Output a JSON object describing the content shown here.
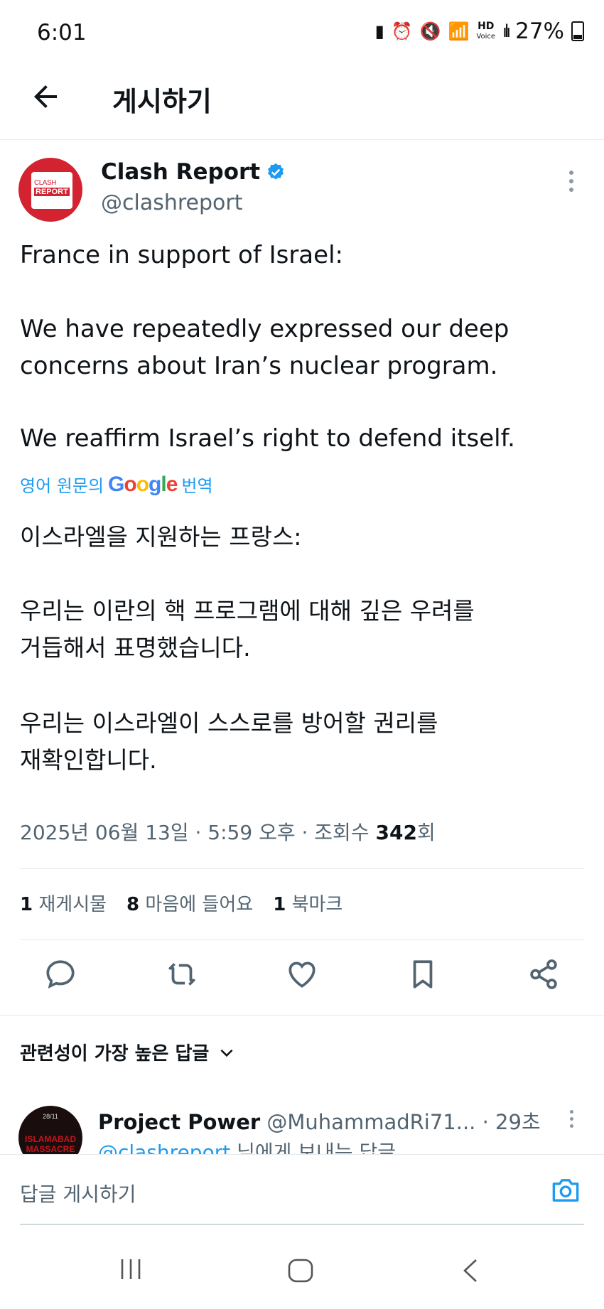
{
  "status_bar": {
    "time": "6:01",
    "network": "HD",
    "network_sub": "Voice",
    "battery": "27%"
  },
  "header": {
    "title": "게시하기"
  },
  "post": {
    "author_name": "Clash Report",
    "author_handle": "@clashreport",
    "avatar_text_top": "CLASH",
    "avatar_text_bottom": "REPORT",
    "text_line1": "France in support of Israel:",
    "text_line2": "We have repeatedly expressed our deep",
    "text_line3": "concerns about Iran’s nuclear program.",
    "text_line4": "We reaffirm Israel’s right to defend itself.",
    "translate_prefix": "영어 원문의",
    "translate_suffix": "번역",
    "translated_line1": "이스라엘을 지원하는 프랑스:",
    "translated_line2": "우리는 이란의 핵 프로그램에 대해 깊은 우려를",
    "translated_line3": "거듭해서 표명했습니다.",
    "translated_line4": "우리는 이스라엘이 스스로를 방어할 권리를",
    "translated_line5": "재확인합니다.",
    "timestamp": "2025년 06월 13일 · 5:59 오후 · 조회수 ",
    "views": "342",
    "views_suffix": "회"
  },
  "stats": {
    "reposts_count": "1",
    "reposts_label": "재게시물",
    "likes_count": "8",
    "likes_label": "마음에 들어요",
    "bookmarks_count": "1",
    "bookmarks_label": "북마크"
  },
  "replies": {
    "sort_label": "관련성이 가장 높은 답글",
    "first_reply": {
      "name": "Project Power",
      "handle": "@MuhammadRi71...",
      "time": "· 29초",
      "replying_to_link": "@clashreport",
      "replying_to_suffix": " 님에게 보내는 답글",
      "avatar_text_top": "28/11",
      "avatar_text": "ISLAMABAD MASSACRE"
    }
  },
  "reply_box": {
    "placeholder": "답글 게시하기"
  },
  "colors": {
    "accent": "#1d9bf0",
    "brand_red": "#d32330",
    "muted": "#536471"
  }
}
